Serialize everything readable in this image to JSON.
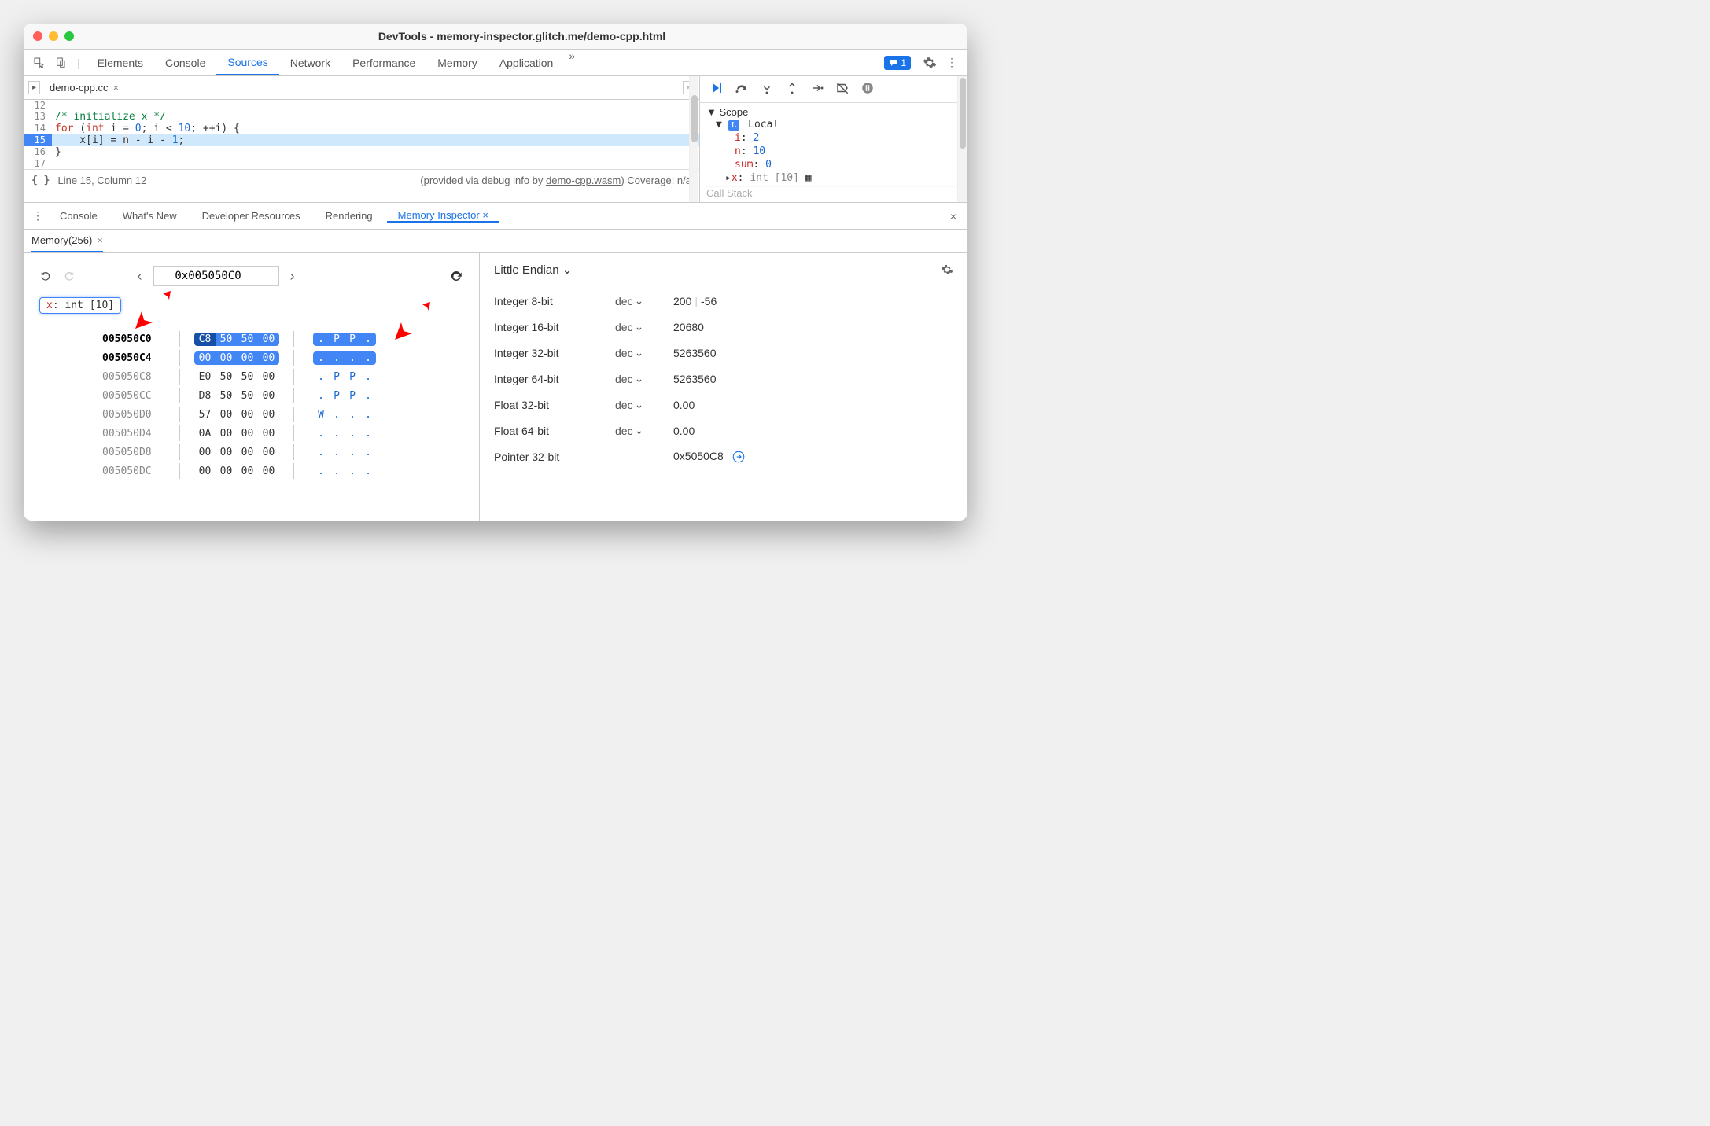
{
  "window": {
    "title": "DevTools - memory-inspector.glitch.me/demo-cpp.html"
  },
  "tabs": {
    "elements": "Elements",
    "console": "Console",
    "sources": "Sources",
    "network": "Network",
    "performance": "Performance",
    "memory": "Memory",
    "application": "Application",
    "more": "»"
  },
  "messages_count": "1",
  "editor_tab": {
    "name": "demo-cpp.cc",
    "close": "×"
  },
  "code": {
    "l12": "12",
    "c12": "",
    "l13": "13",
    "c13_comment": "/* initialize x */",
    "l14": "14",
    "c14_for": "for",
    "c14_rest1": " (",
    "c14_int": "int",
    "c14_rest2": " i = ",
    "c14_z": "0",
    "c14_rest3": "; i < ",
    "c14_ten": "10",
    "c14_rest4": "; ++i) {",
    "l15": "15",
    "c15_pre": "    x[i] = ",
    "c15_n": "n",
    "c15_post": " - i - ",
    "c15_one": "1",
    "c15_semi": ";",
    "l16": "16",
    "c16": "}",
    "l17": "17"
  },
  "status": {
    "pos": "Line 15, Column 12",
    "info_pre": "(provided via debug info by ",
    "info_link": "demo-cpp.wasm",
    "info_post": ") Coverage: n/a"
  },
  "scope": {
    "header": "Scope",
    "local": "Local",
    "vars": {
      "i": {
        "name": "i",
        "val": "2"
      },
      "n": {
        "name": "n",
        "val": "10"
      },
      "sum": {
        "name": "sum",
        "val": "0"
      },
      "x": {
        "name": "x",
        "type": "int [10]"
      }
    },
    "callstack": "Call Stack"
  },
  "drawer": {
    "console": "Console",
    "whatsnew": "What's New",
    "devres": "Developer Resources",
    "rendering": "Rendering",
    "meminsp": "Memory Inspector",
    "close_active": "×"
  },
  "memory_tab": {
    "label": "Memory(256)",
    "close": "×"
  },
  "hex": {
    "address": "0x005050C0",
    "chip_var": "x",
    "chip_type": ": int [10]",
    "rows": [
      {
        "addr": "005050C0",
        "b": [
          "C8",
          "50",
          "50",
          "00"
        ],
        "a": [
          ".",
          "P",
          "P",
          "."
        ],
        "hl": true,
        "first": true
      },
      {
        "addr": "005050C4",
        "b": [
          "00",
          "00",
          "00",
          "00"
        ],
        "a": [
          ".",
          ".",
          ".",
          "."
        ],
        "hl": true
      },
      {
        "addr": "005050C8",
        "b": [
          "E0",
          "50",
          "50",
          "00"
        ],
        "a": [
          ".",
          "P",
          "P",
          "."
        ]
      },
      {
        "addr": "005050CC",
        "b": [
          "D8",
          "50",
          "50",
          "00"
        ],
        "a": [
          ".",
          "P",
          "P",
          "."
        ]
      },
      {
        "addr": "005050D0",
        "b": [
          "57",
          "00",
          "00",
          "00"
        ],
        "a": [
          "W",
          ".",
          ".",
          "."
        ]
      },
      {
        "addr": "005050D4",
        "b": [
          "0A",
          "00",
          "00",
          "00"
        ],
        "a": [
          ".",
          ".",
          ".",
          "."
        ]
      },
      {
        "addr": "005050D8",
        "b": [
          "00",
          "00",
          "00",
          "00"
        ],
        "a": [
          ".",
          ".",
          ".",
          "."
        ]
      },
      {
        "addr": "005050DC",
        "b": [
          "00",
          "00",
          "00",
          "00"
        ],
        "a": [
          ".",
          ".",
          ".",
          "."
        ]
      }
    ]
  },
  "values": {
    "endian": "Little Endian",
    "fmt": "dec",
    "rows": {
      "i8": {
        "label": "Integer 8-bit",
        "v": "200",
        "v2": "-56"
      },
      "i16": {
        "label": "Integer 16-bit",
        "v": "20680"
      },
      "i32": {
        "label": "Integer 32-bit",
        "v": "5263560"
      },
      "i64": {
        "label": "Integer 64-bit",
        "v": "5263560"
      },
      "f32": {
        "label": "Float 32-bit",
        "v": "0.00"
      },
      "f64": {
        "label": "Float 64-bit",
        "v": "0.00"
      },
      "p32": {
        "label": "Pointer 32-bit",
        "v": "0x5050C8"
      }
    }
  }
}
